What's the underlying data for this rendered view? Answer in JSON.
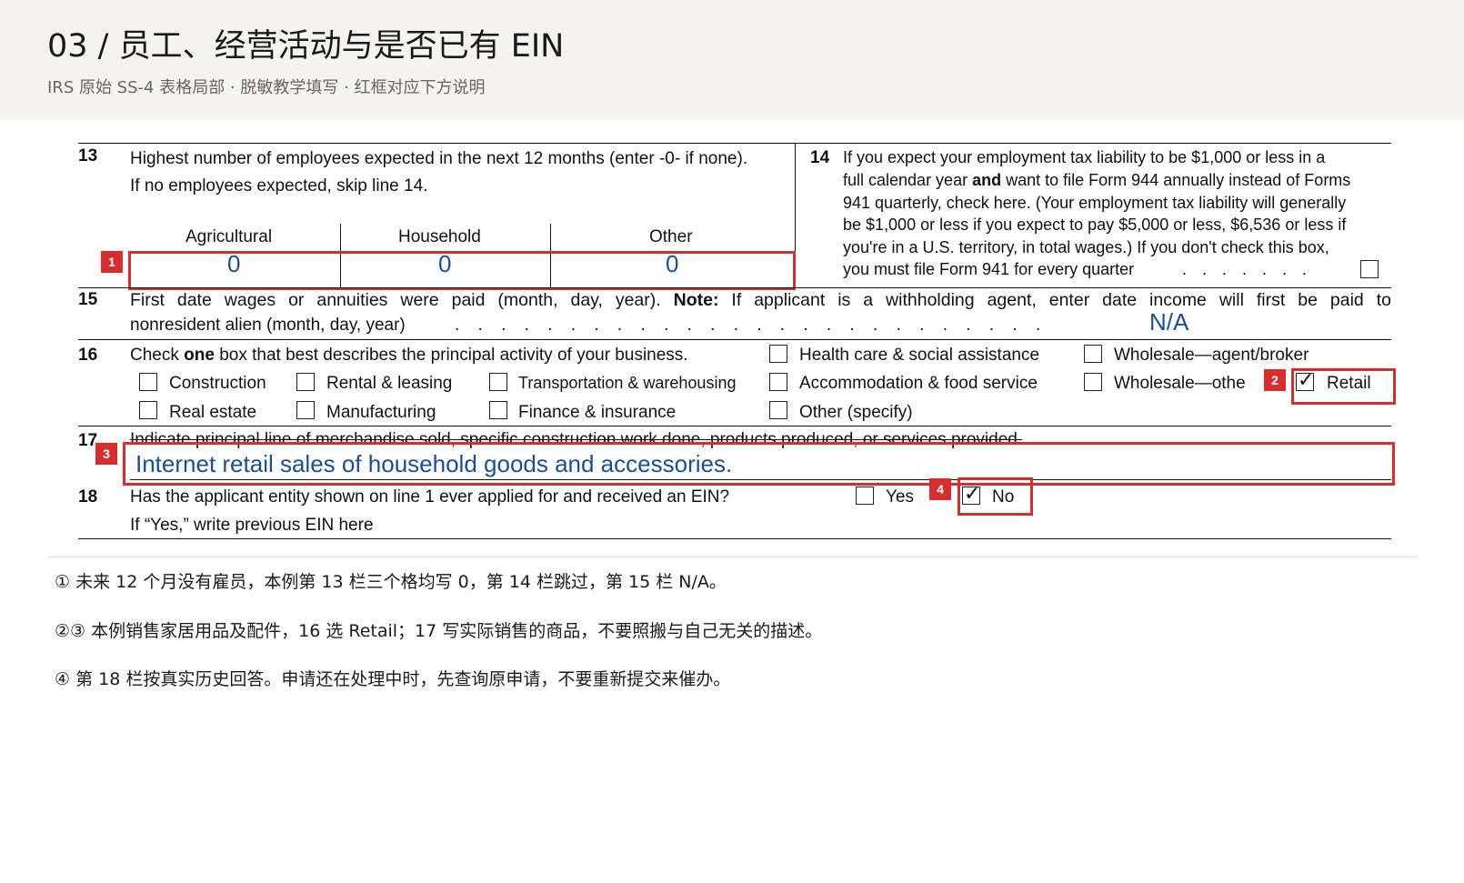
{
  "header": {
    "title": "03 / 员工、经营活动与是否已有 EIN",
    "subtitle": "IRS 原始 SS-4 表格局部 · 脱敏教学填写 · 红框对应下方说明"
  },
  "form": {
    "line13": {
      "number": "13",
      "text1": "Highest number of employees expected in the next 12 months (enter -0- if none).",
      "text2": "If no employees expected, skip line 14.",
      "columns": [
        "Agricultural",
        "Household",
        "Other"
      ],
      "values": [
        "0",
        "0",
        "0"
      ]
    },
    "line14": {
      "number": "14",
      "lines": [
        "If you expect your employment tax liability to be $1,000 or less in a",
        "want to file Form 944 annually instead of Forms",
        "941 quarterly, check here. (Your employment tax liability will generally",
        "be $1,000 or less if you expect to pay $5,000 or less, $6,536 or less if",
        "you're in a U.S. territory, in total wages.) If you don't check this box,",
        "you must file Form 941 for every quarter"
      ],
      "line2_prefix": "full calendar year",
      "line2_bold": "and",
      "dots": ". . . . . . ."
    },
    "line15": {
      "number": "15",
      "text1_a": "First date wages or annuities were paid (month, day, year).",
      "note_label": "Note:",
      "text1_b": "If applicant is a withholding agent, enter date income will first be paid to",
      "text2": "nonresident alien (month, day, year)",
      "dots": ". . . . . . . . . . . . . . . . . . . . . . . . . .",
      "value": "N/A"
    },
    "line16": {
      "number": "16",
      "text_a": "Check",
      "text_bold": "one",
      "text_b": "box that best describes the principal activity of your business.",
      "options": {
        "health_care": "Health care & social assistance",
        "wholesale_agent": "Wholesale—agent/broker",
        "construction": "Construction",
        "rental": "Rental & leasing",
        "transportation": "Transportation & warehousing",
        "accommodation": "Accommodation & food service",
        "wholesale_other": "Wholesale—othe",
        "retail": "Retail",
        "real_estate": "Real estate",
        "manufacturing": "Manufacturing",
        "finance": "Finance & insurance",
        "other": "Other (specify)"
      },
      "selected": "Retail"
    },
    "line17": {
      "number": "17",
      "text": "Indicate principal line of merchandise sold, specific construction work done, products produced, or services provided.",
      "value": "Internet retail sales of household goods and accessories."
    },
    "line18": {
      "number": "18",
      "text1": "Has the applicant entity shown on line 1 ever applied for and received an EIN?",
      "text2": "If “Yes,” write previous EIN here",
      "yes_label": "Yes",
      "no_label": "No",
      "selected": "No"
    },
    "badges": [
      "1",
      "2",
      "3",
      "4"
    ],
    "annotation_color": "#d32f2f",
    "fill_color": "#1c4f8f"
  },
  "notes": [
    "① 未来 12 个月没有雇员，本例第 13 栏三个格均写 0，第 14 栏跳过，第 15 栏 N/A。",
    "②③ 本例销售家居用品及配件，16 选 Retail；17 写实际销售的商品，不要照搬与自己无关的描述。",
    "④ 第 18 栏按真实历史回答。申请还在处理中时，先查询原申请，不要重新提交来催办。"
  ]
}
